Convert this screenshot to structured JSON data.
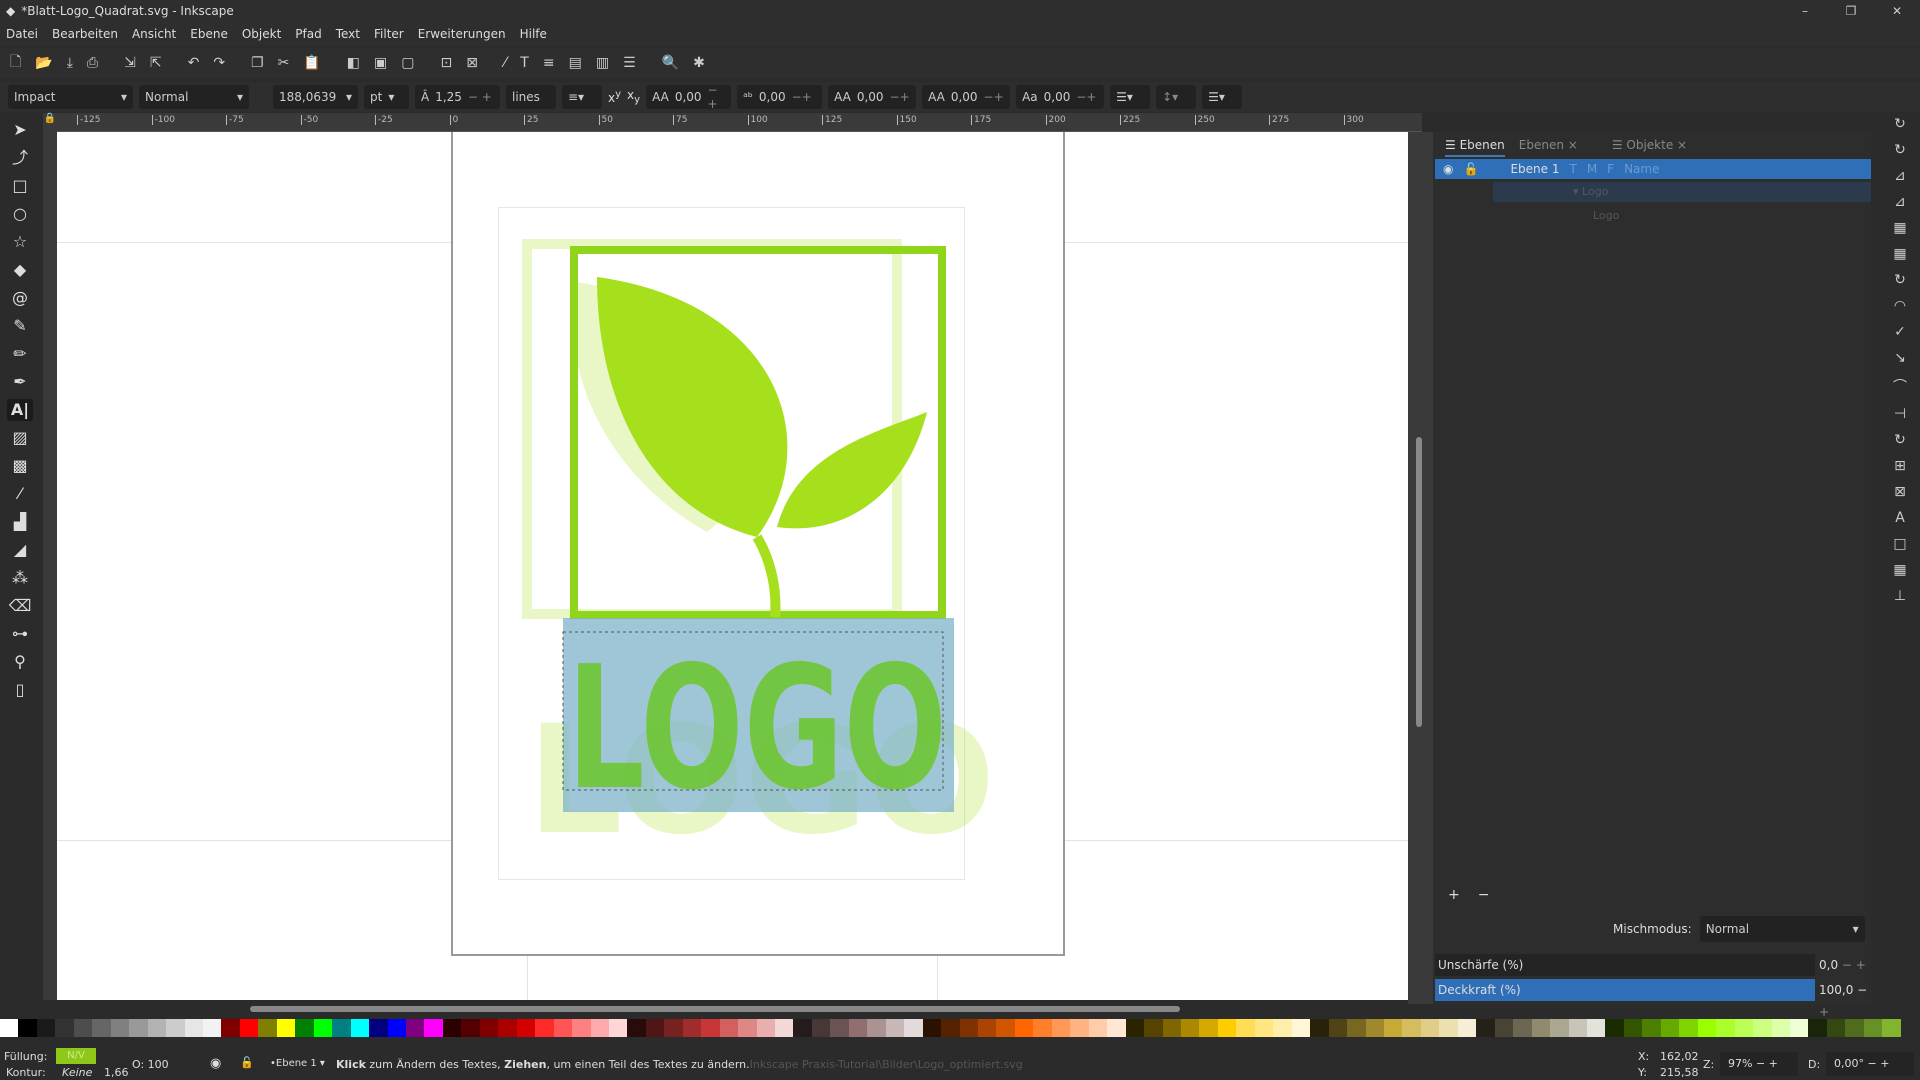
{
  "window": {
    "title": "*Blatt-Logo_Quadrat.svg - Inkscape",
    "controls": [
      "–",
      "❐",
      "✕"
    ]
  },
  "menu": [
    "Datei",
    "Bearbeiten",
    "Ansicht",
    "Ebene",
    "Objekt",
    "Pfad",
    "Text",
    "Filter",
    "Erweiterungen",
    "Hilfe"
  ],
  "toolbar_icons": [
    "new-document",
    "open",
    "save",
    "print",
    "import",
    "export",
    "undo",
    "redo",
    "duplicate",
    "cut",
    "paste",
    "group-front",
    "group",
    "ungroup",
    "zoom-selection",
    "zoom-drawing",
    "edit-xml",
    "text-font",
    "align",
    "document-properties",
    "layers",
    "objects",
    "find",
    "preferences"
  ],
  "textbar": {
    "font_family": "Impact",
    "font_style": "Normal",
    "font_size": "188,0639",
    "unit": "pt",
    "line_height": "1,25",
    "line_unit": "lines",
    "word_spacing": "0,00",
    "letter_spacing": "0,00",
    "kerning": "0,00",
    "vertical_shift": "0,00",
    "rotation": "0,00"
  },
  "ruler_ticks": [
    "-125",
    "-100",
    "-75",
    "-50",
    "-25",
    "0",
    "25",
    "50",
    "75",
    "100",
    "125",
    "150",
    "175",
    "200",
    "225",
    "250",
    "275",
    "300"
  ],
  "canvas": {
    "logo_text": "LOGO",
    "leaf_color": "#a6e01c",
    "frame_color": "#8fd61a",
    "selection_color": "#7fb3c8"
  },
  "panel": {
    "tabs": [
      "Ebenen",
      "Ebenen",
      "Objekte"
    ],
    "layer_row": {
      "name": "Ebene 1",
      "cols": [
        "T",
        "M",
        "F",
        "Name"
      ]
    },
    "ghost_rows": [
      "Logo",
      "Logo"
    ],
    "blend_label": "Mischmodus:",
    "blend_value": "Normal",
    "blur_label": "Unschärfe (%)",
    "blur_value": "0,0",
    "opacity_label": "Deckkraft (%)",
    "opacity_value": "100,0"
  },
  "palette": [
    "#ffffff",
    "#000000",
    "#1a1a1a",
    "#333333",
    "#4d4d4d",
    "#666666",
    "#808080",
    "#999999",
    "#b3b3b3",
    "#cccccc",
    "#e6e6e6",
    "#f2f2f2",
    "#800000",
    "#ff0000",
    "#808000",
    "#ffff00",
    "#008000",
    "#00ff00",
    "#008080",
    "#00ffff",
    "#000080",
    "#0000ff",
    "#800080",
    "#ff00ff",
    "#2b0000",
    "#550000",
    "#800000",
    "#aa0000",
    "#d40000",
    "#ff2a2a",
    "#ff5555",
    "#ff8080",
    "#ffaaaa",
    "#ffd5d5",
    "#280b0b",
    "#501616",
    "#782121",
    "#a02c2c",
    "#c83737",
    "#d35f5f",
    "#de8787",
    "#e9afaf",
    "#f4d7d7",
    "#241c1c",
    "#483737",
    "#6c5353",
    "#916f6f",
    "#ac9393",
    "#c8b7b7",
    "#e3dbdb",
    "#2b1100",
    "#552200",
    "#803300",
    "#aa4400",
    "#d45500",
    "#ff6600",
    "#ff7f2a",
    "#ff9955",
    "#ffb380",
    "#ffccaa",
    "#ffe6d5",
    "#2b2200",
    "#554400",
    "#806600",
    "#aa8800",
    "#d4aa00",
    "#ffcc00",
    "#ffdd55",
    "#ffe680",
    "#ffeeaa",
    "#fff6d5",
    "#28220b",
    "#504416",
    "#786721",
    "#a0892c",
    "#c8ab37",
    "#d4bc5f",
    "#e0cd87",
    "#ece0af",
    "#f6eed7",
    "#242218",
    "#484537",
    "#6c6753",
    "#918a6f",
    "#aca793",
    "#c8c4b7",
    "#e3e2db",
    "#1a2b00",
    "#335500",
    "#4d8000",
    "#66aa00",
    "#80d400",
    "#99ff00",
    "#aaff2a",
    "#bbff55",
    "#ccff80",
    "#ddffaa",
    "#eeffd5",
    "#1a2408",
    "#344812",
    "#4e6c1b",
    "#689125",
    "#82b52d"
  ],
  "status": {
    "fill_label": "Füllung:",
    "fill_value": "N/V",
    "stroke_label": "Kontur:",
    "stroke_value": "Keine",
    "stroke_width": "1,66",
    "opacity": "O: 100",
    "layer": "•Ebene 1",
    "msg_b1": "Klick",
    "msg_1": " zum Ändern des Textes, ",
    "msg_b2": "Ziehen",
    "msg_2": ", um einen Teil des Textes zu ändern.",
    "msg_ghost": "Inkscape Praxis-Tutorial\\Bilder\\Logo_optimiert.svg",
    "x_label": "X:",
    "x": "162,02",
    "y_label": "Y:",
    "y": "215,58",
    "zoom_label": "Z:",
    "zoom": "97%",
    "rot_label": "D:",
    "rotation": "0,00°"
  }
}
